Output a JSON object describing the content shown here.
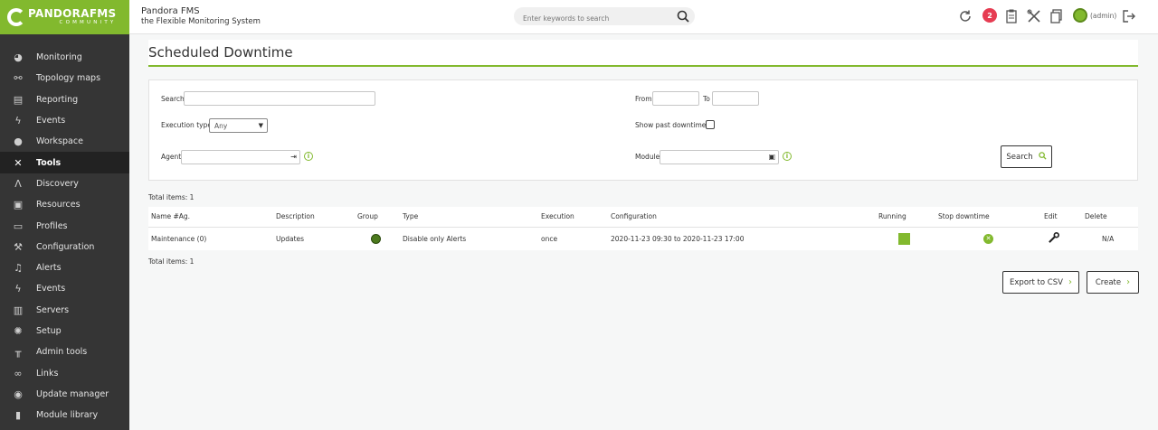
{
  "logo": {
    "brand": "PANDORAFMS",
    "sub": "COMMUNITY"
  },
  "header": {
    "product": "Pandora FMS",
    "slogan": "the Flexible Monitoring System",
    "search_placeholder": "Enter keywords to search",
    "badge_count": "2",
    "user": "(admin)"
  },
  "menu": [
    {
      "label": "Monitoring",
      "icon": "monitoring-icon"
    },
    {
      "label": "Topology maps",
      "icon": "topology-icon"
    },
    {
      "label": "Reporting",
      "icon": "reporting-icon"
    },
    {
      "label": "Events",
      "icon": "bolt-icon"
    },
    {
      "label": "Workspace",
      "icon": "person-icon"
    },
    {
      "label": "Tools",
      "icon": "tools-icon"
    },
    {
      "label": "Discovery",
      "icon": "discovery-icon"
    },
    {
      "label": "Resources",
      "icon": "resources-icon"
    },
    {
      "label": "Profiles",
      "icon": "profiles-icon"
    },
    {
      "label": "Configuration",
      "icon": "wrench-icon"
    },
    {
      "label": "Alerts",
      "icon": "bell-icon"
    },
    {
      "label": "Events",
      "icon": "bolt-icon"
    },
    {
      "label": "Servers",
      "icon": "servers-icon"
    },
    {
      "label": "Setup",
      "icon": "gear-icon"
    },
    {
      "label": "Admin tools",
      "icon": "admin-tools-icon"
    },
    {
      "label": "Links",
      "icon": "link-icon"
    },
    {
      "label": "Update manager",
      "icon": "update-icon"
    },
    {
      "label": "Module library",
      "icon": "library-icon"
    }
  ],
  "page": {
    "title": "Scheduled Downtime",
    "total_items": "Total items: 1"
  },
  "filter": {
    "search_label": "Search",
    "execution_type_label": "Execution type",
    "execution_type_value": "Any",
    "agent_label": "Agent",
    "from_label": "From",
    "to_label": "To",
    "show_past_label": "Show past downtimes",
    "module_label": "Module",
    "search_button": "Search"
  },
  "table": {
    "headers": [
      "Name #Ag.",
      "Description",
      "Group",
      "Type",
      "Execution",
      "Configuration",
      "Running",
      "Stop downtime",
      "Edit",
      "Delete"
    ],
    "rows": [
      {
        "name": "Maintenance (0)",
        "description": "Updates",
        "type": "Disable only Alerts",
        "execution": "once",
        "configuration": "2020-11-23 09:30 to 2020-11-23 17:00",
        "delete": "N/A"
      }
    ]
  },
  "actions": {
    "export": "Export to CSV",
    "create": "Create"
  }
}
